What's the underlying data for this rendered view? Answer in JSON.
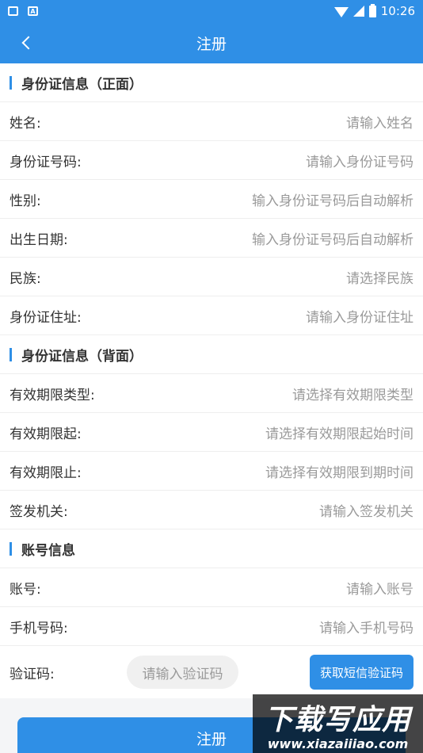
{
  "status_bar": {
    "time": "10:26",
    "left_icons": [
      "mail-icon",
      "a-icon"
    ],
    "a_icon_text": "A"
  },
  "header": {
    "title": "注册",
    "back_icon": "chevron-left-icon"
  },
  "sections": {
    "front": {
      "title": "身份证信息（正面）",
      "rows": [
        {
          "label": "姓名:",
          "placeholder": "请输入姓名"
        },
        {
          "label": "身份证号码:",
          "placeholder": "请输入身份证号码"
        },
        {
          "label": "性别:",
          "placeholder": "输入身份证号码后自动解析"
        },
        {
          "label": "出生日期:",
          "placeholder": "输入身份证号码后自动解析"
        },
        {
          "label": "民族:",
          "placeholder": "请选择民族"
        },
        {
          "label": "身份证住址:",
          "placeholder": "请输入身份证住址"
        }
      ]
    },
    "back": {
      "title": "身份证信息（背面）",
      "rows": [
        {
          "label": "有效期限类型:",
          "placeholder": "请选择有效期限类型"
        },
        {
          "label": "有效期限起:",
          "placeholder": "请选择有效期限起始时间"
        },
        {
          "label": "有效期限止:",
          "placeholder": "请选择有效期限到期时间"
        },
        {
          "label": "签发机关:",
          "placeholder": "请输入签发机关"
        }
      ]
    },
    "account": {
      "title": "账号信息",
      "rows": [
        {
          "label": "账号:",
          "placeholder": "请输入账号"
        },
        {
          "label": "手机号码:",
          "placeholder": "请输入手机号码"
        }
      ]
    }
  },
  "verify": {
    "label": "验证码:",
    "placeholder": "请输入验证码",
    "button": "获取短信验证码"
  },
  "submit_label": "注册",
  "watermark": {
    "line1": "下载写应用",
    "line2": "www.xiazaiiiao.com"
  },
  "colors": {
    "accent": "#2f8fe6",
    "placeholder": "#9a9a9a",
    "text": "#333333"
  }
}
